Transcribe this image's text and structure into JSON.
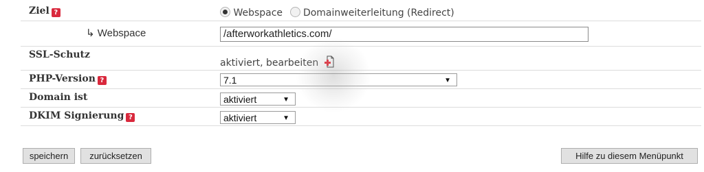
{
  "rows": {
    "ziel": {
      "label": "Ziel",
      "options": [
        "Webspace",
        "Domainweiterleitung (Redirect)"
      ],
      "selected": "Webspace"
    },
    "webspace": {
      "label": "↳ Webspace",
      "value": "/afterworkathletics.com/"
    },
    "ssl": {
      "label": "SSL-Schutz",
      "status_text": "aktiviert, bearbeiten"
    },
    "php": {
      "label": "PHP-Version",
      "value": "7.1"
    },
    "domain": {
      "label": "Domain ist",
      "value": "aktiviert"
    },
    "dkim": {
      "label": "DKIM Signierung",
      "value": "aktiviert"
    }
  },
  "buttons": {
    "save": "speichern",
    "reset": "zurücksetzen",
    "help": "Hilfe zu diesem Menüpunkt"
  },
  "icons": {
    "help": "help-icon",
    "ssl_edit": "add-document-icon"
  },
  "colors": {
    "help_icon": "#d9293d",
    "ssl_plus": "#e8202f",
    "row_border": "#dcdcdc"
  }
}
